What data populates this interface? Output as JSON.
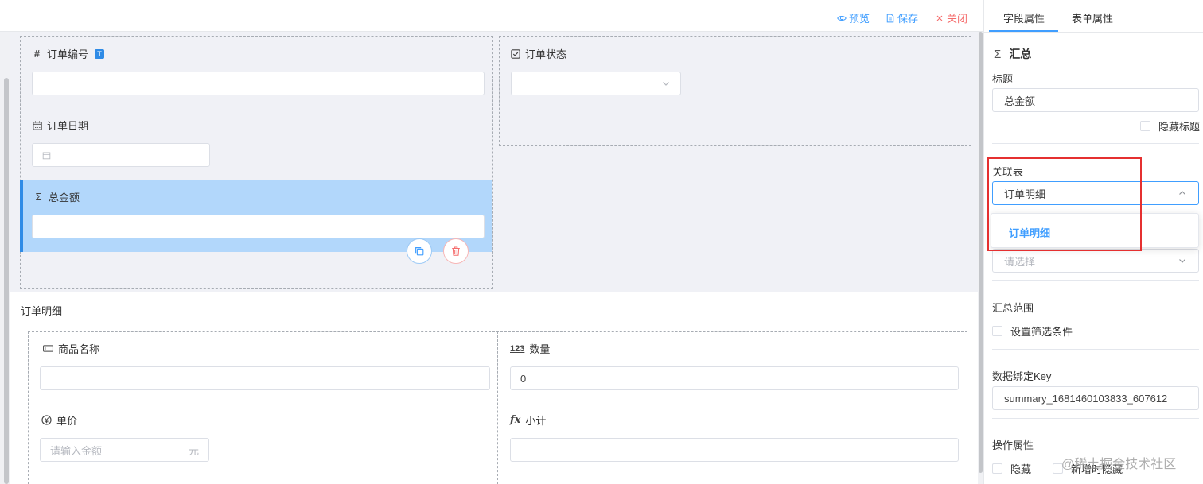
{
  "toolbar": {
    "preview": "预览",
    "save": "保存",
    "close": "关闭"
  },
  "form": {
    "order_no": {
      "label": "订单编号",
      "badge": "T",
      "value": ""
    },
    "order_status": {
      "label": "订单状态",
      "value": ""
    },
    "order_date": {
      "label": "订单日期",
      "value": ""
    },
    "total_amount": {
      "label": "总金额",
      "value": ""
    }
  },
  "subform": {
    "title": "订单明细",
    "product_name": {
      "label": "商品名称",
      "value": ""
    },
    "quantity": {
      "label": "数量",
      "icon_text": "123",
      "value": "0"
    },
    "unit_price": {
      "label": "单价",
      "placeholder": "请输入金额",
      "suffix": "元"
    },
    "subtotal": {
      "label": "小计",
      "icon_text": "fx",
      "value": ""
    }
  },
  "panel": {
    "tabs": [
      "字段属性",
      "表单属性"
    ],
    "active_tab": 0,
    "component": {
      "icon": "Σ",
      "name": "汇总"
    },
    "title_label": "标题",
    "title_value": "总金额",
    "hide_title": "隐藏标题",
    "related_table_label": "关联表",
    "related_table_value": "订单明细",
    "dropdown_option": "订单明细",
    "field_placeholder": "请选择",
    "summary_range_label": "汇总范围",
    "filter_checkbox": "设置筛选条件",
    "binding_key_label": "数据绑定Key",
    "binding_key_value": "summary_1681460103833_607612",
    "operation_label": "操作属性",
    "hidden_checkbox": "隐藏",
    "hide_on_add_checkbox": "新增时隐藏"
  },
  "watermark": "@稀土掘金技术社区",
  "colors": {
    "primary": "#409eff",
    "danger": "#f56c6c",
    "selected_bg": "#b2d7fb",
    "highlight_box": "#e53030"
  }
}
